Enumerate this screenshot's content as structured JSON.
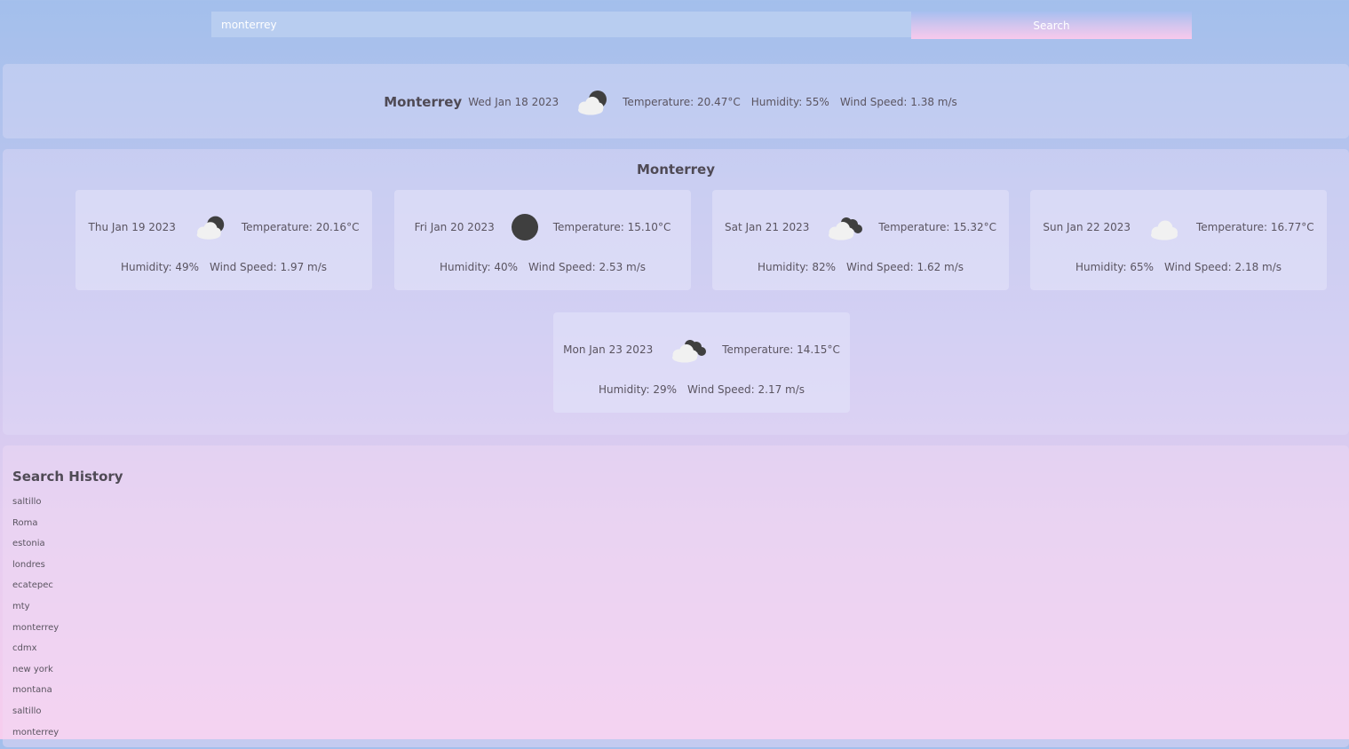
{
  "search": {
    "value": "monterrey",
    "button_label": "Search"
  },
  "current": {
    "city": "Monterrey",
    "date": "Wed Jan 18 2023",
    "icon": "cloud-moon-icon",
    "temperature": "Temperature: 20.47°C",
    "humidity": "Humidity: 55%",
    "wind": "Wind Speed: 1.38 m/s"
  },
  "forecast": {
    "city": "Monterrey",
    "days": [
      {
        "date": "Thu Jan 19 2023",
        "icon": "cloud-moon-icon",
        "temperature": "Temperature: 20.16°C",
        "humidity": "Humidity: 49%",
        "wind": "Wind Speed: 1.97 m/s"
      },
      {
        "date": "Fri Jan 20 2023",
        "icon": "moon-icon",
        "temperature": "Temperature: 15.10°C",
        "humidity": "Humidity: 40%",
        "wind": "Wind Speed: 2.53 m/s"
      },
      {
        "date": "Sat Jan 21 2023",
        "icon": "cloud-dark-clouds-icon",
        "temperature": "Temperature: 15.32°C",
        "humidity": "Humidity: 82%",
        "wind": "Wind Speed: 1.62 m/s"
      },
      {
        "date": "Sun Jan 22 2023",
        "icon": "cloud-icon",
        "temperature": "Temperature: 16.77°C",
        "humidity": "Humidity: 65%",
        "wind": "Wind Speed: 2.18 m/s"
      },
      {
        "date": "Mon Jan 23 2023",
        "icon": "cloud-dark-clouds-icon",
        "temperature": "Temperature: 14.15°C",
        "humidity": "Humidity: 29%",
        "wind": "Wind Speed: 2.17 m/s"
      }
    ]
  },
  "history": {
    "title": "Search History",
    "items": [
      "saltillo",
      "Roma",
      "estonia",
      "londres",
      "ecatepec",
      "mty",
      "monterrey",
      "cdmx",
      "new york",
      "montana",
      "saltillo",
      "monterrey"
    ]
  },
  "colors": {
    "icon_dark": "#3f3f3f",
    "icon_light": "#f1f1f1",
    "button_gradient_top": "#a7bff0",
    "button_gradient_bottom": "#f8c9ec"
  }
}
